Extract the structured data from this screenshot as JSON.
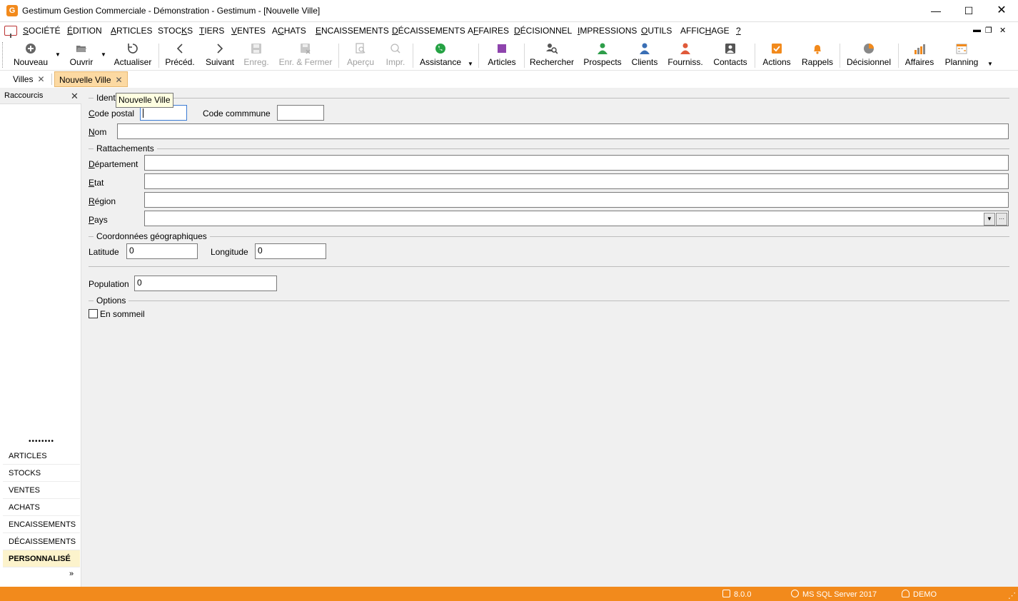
{
  "window": {
    "title": "Gestimum Gestion Commerciale - Démonstration - Gestimum - [Nouvelle Ville]",
    "app_icon_letter": "G",
    "minimize": "—",
    "maximize": "☐",
    "close": "✕"
  },
  "menu": {
    "items": [
      {
        "pre": "",
        "ul": "S",
        "post": "OCIÉTÉ"
      },
      {
        "pre": "",
        "ul": "É",
        "post": "DITION"
      },
      {
        "pre": "",
        "ul": "A",
        "post": "RTICLES"
      },
      {
        "pre": "STOC",
        "ul": "K",
        "post": "S"
      },
      {
        "pre": "",
        "ul": "T",
        "post": "IERS"
      },
      {
        "pre": "",
        "ul": "V",
        "post": "ENTES"
      },
      {
        "pre": "A",
        "ul": "C",
        "post": "HATS"
      },
      {
        "pre": "",
        "ul": "E",
        "post": "NCAISSEMENTS"
      },
      {
        "pre": "",
        "ul": "D",
        "post": "ÉCAISSEMENTS"
      },
      {
        "pre": "A",
        "ul": "F",
        "post": "FAIRES"
      },
      {
        "pre": "",
        "ul": "D",
        "post": "ÉCISIONNEL"
      },
      {
        "pre": "",
        "ul": "I",
        "post": "MPRESSIONS"
      },
      {
        "pre": "",
        "ul": "O",
        "post": "UTILS"
      },
      {
        "pre": "AFFIC",
        "ul": "H",
        "post": "AGE"
      },
      {
        "pre": "",
        "ul": "?",
        "post": ""
      }
    ],
    "mdi_min": "▬",
    "mdi_restore": "❐",
    "mdi_close": "✕"
  },
  "toolbar": {
    "buttons": [
      {
        "label": "Nouveau",
        "icon": "plus-circle-icon",
        "disabled": false
      },
      {
        "label": "Ouvrir",
        "icon": "folder-open-icon",
        "disabled": false
      },
      {
        "label": "Actualiser",
        "icon": "refresh-icon",
        "disabled": false
      },
      {
        "label": "Précéd.",
        "icon": "chevron-left-icon",
        "disabled": false
      },
      {
        "label": "Suivant",
        "icon": "chevron-right-icon",
        "disabled": false
      },
      {
        "label": "Enreg.",
        "icon": "save-icon",
        "disabled": true
      },
      {
        "label": "Enr. & Fermer",
        "icon": "save-close-icon",
        "disabled": true
      },
      {
        "label": "Aperçu",
        "icon": "preview-icon",
        "disabled": true
      },
      {
        "label": "Impr.",
        "icon": "print-icon",
        "disabled": true
      },
      {
        "label": "Assistance",
        "icon": "whatsapp-icon",
        "disabled": false
      },
      {
        "label": "Articles",
        "icon": "articles-icon",
        "disabled": false
      },
      {
        "label": "Rechercher",
        "icon": "search-icon",
        "disabled": false
      },
      {
        "label": "Prospects",
        "icon": "prospect-person-icon",
        "disabled": false
      },
      {
        "label": "Clients",
        "icon": "client-person-icon",
        "disabled": false
      },
      {
        "label": "Fourniss.",
        "icon": "supplier-person-icon",
        "disabled": false
      },
      {
        "label": "Contacts",
        "icon": "contact-card-icon",
        "disabled": false
      },
      {
        "label": "Actions",
        "icon": "checkbox-action-icon",
        "disabled": false
      },
      {
        "label": "Rappels",
        "icon": "bell-icon",
        "disabled": false
      },
      {
        "label": "Décisionnel",
        "icon": "pie-chart-icon",
        "disabled": false
      },
      {
        "label": "Affaires",
        "icon": "bar-chart-icon",
        "disabled": false
      },
      {
        "label": "Planning",
        "icon": "calendar-grid-icon",
        "disabled": false
      }
    ],
    "colors": {
      "whatsapp": "#25a244",
      "articles": "#8e44ad",
      "prospects": "#2e9e4a",
      "clients": "#3a6fb5",
      "suppliers": "#e05a3a",
      "orange": "#f28a1c"
    }
  },
  "tabs": [
    {
      "label": "Villes",
      "close": "✕",
      "active": false
    },
    {
      "label": "Nouvelle Ville",
      "close": "✕",
      "active": true
    }
  ],
  "sidebar": {
    "title": "Raccourcis",
    "close": "✕",
    "dots": "••••••••",
    "nav": [
      "ARTICLES",
      "STOCKS",
      "VENTES",
      "ACHATS",
      "ENCAISSEMENTS",
      "DÉCAISSEMENTS",
      "PERSONNALISÉ"
    ],
    "active_index": 6,
    "more": "»"
  },
  "form": {
    "group_identification": "Ident",
    "tooltip": "Nouvelle Ville",
    "code_postal": {
      "pre": "",
      "ul": "C",
      "post": "ode postal",
      "value": ""
    },
    "code_commune": {
      "label": "Code commmune",
      "value": ""
    },
    "nom": {
      "pre": "",
      "ul": "N",
      "post": "om",
      "value": ""
    },
    "group_rattachements": "Rattachements",
    "departement": {
      "pre": "",
      "ul": "D",
      "post": "épartement",
      "value": ""
    },
    "etat": {
      "pre": "",
      "ul": "E",
      "post": "tat",
      "value": ""
    },
    "region": {
      "pre": "",
      "ul": "R",
      "post": "égion",
      "value": ""
    },
    "pays": {
      "pre": "",
      "ul": "P",
      "post": "ays",
      "value": "",
      "drop": "▼",
      "ellipsis": "···"
    },
    "group_coords": "Coordonnées géographiques",
    "latitude": {
      "label": "Latitude",
      "value": "0"
    },
    "longitude": {
      "label": "Longitude",
      "value": "0"
    },
    "population": {
      "label": "Population",
      "value": "0"
    },
    "group_options": "Options",
    "en_sommeil": {
      "label": "En sommeil",
      "checked": false
    }
  },
  "status": {
    "version": "8.0.0",
    "database": "MS SQL Server 2017",
    "user": "DEMO"
  }
}
